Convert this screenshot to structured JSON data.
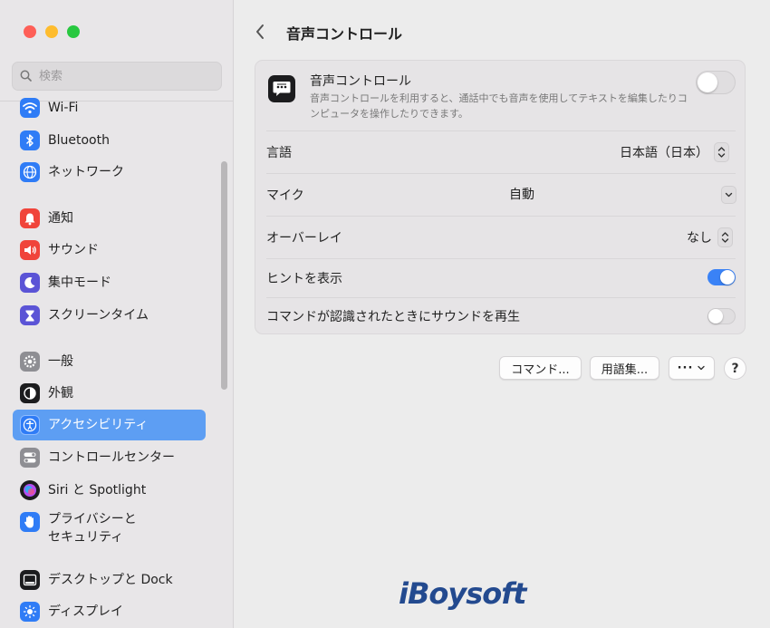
{
  "sidebar": {
    "search_placeholder": "検索",
    "items": [
      {
        "label": "Wi-Fi",
        "icon": "wifi-icon",
        "color": "#2f7cf6"
      },
      {
        "label": "Bluetooth",
        "icon": "bluetooth-icon",
        "color": "#2f7cf6"
      },
      {
        "label": "ネットワーク",
        "icon": "globe-icon",
        "color": "#2f7cf6"
      },
      {
        "label": "通知",
        "icon": "bell-icon",
        "color": "#f0443a"
      },
      {
        "label": "サウンド",
        "icon": "speaker-icon",
        "color": "#f0443a"
      },
      {
        "label": "集中モード",
        "icon": "moon-icon",
        "color": "#5b54d6"
      },
      {
        "label": "スクリーンタイム",
        "icon": "hourglass-icon",
        "color": "#5b54d6"
      },
      {
        "label": "一般",
        "icon": "gear-icon",
        "color": "#8e8e93"
      },
      {
        "label": "外観",
        "icon": "appearance-icon",
        "color": "#1c1c1e"
      },
      {
        "label": "アクセシビリティ",
        "icon": "accessibility-icon",
        "color": "#2f7cf6"
      },
      {
        "label": "コントロールセンター",
        "icon": "switches-icon",
        "color": "#8e8e93"
      },
      {
        "label": "Siri と Spotlight",
        "icon": "siri-icon",
        "color": "#6a3fd1"
      },
      {
        "label": "プライバシーと\nセキュリティ",
        "label_line1": "プライバシーと",
        "label_line2": "セキュリティ",
        "icon": "hand-icon",
        "color": "#2f7cf6"
      },
      {
        "label": "デスクトップと Dock",
        "icon": "dock-icon",
        "color": "#1c1c1e"
      },
      {
        "label": "ディスプレイ",
        "icon": "sun-icon",
        "color": "#2f7cf6"
      }
    ],
    "selected": "アクセシビリティ"
  },
  "header": {
    "title": "音声コントロール"
  },
  "voice_control": {
    "title": "音声コントロール",
    "description": "音声コントロールを利用すると、通話中でも音声を使用してテキストを編集したりコンピュータを操作したりできます。",
    "enabled": false
  },
  "settings": {
    "language_label": "言語",
    "language_value": "日本語（日本）",
    "mic_label": "マイク",
    "mic_value": "自動",
    "overlay_label": "オーバーレイ",
    "overlay_value": "なし",
    "hints_label": "ヒントを表示",
    "hints_enabled": true,
    "sound_label": "コマンドが認識されたときにサウンドを再生",
    "sound_enabled": false
  },
  "buttons": {
    "commands": "コマンド...",
    "vocabulary": "用語集...",
    "more": "···",
    "help": "?"
  },
  "watermark": "iBoysoft",
  "colors": {
    "accent": "#3a82f6",
    "selected_bg": "#5d9ef3"
  }
}
